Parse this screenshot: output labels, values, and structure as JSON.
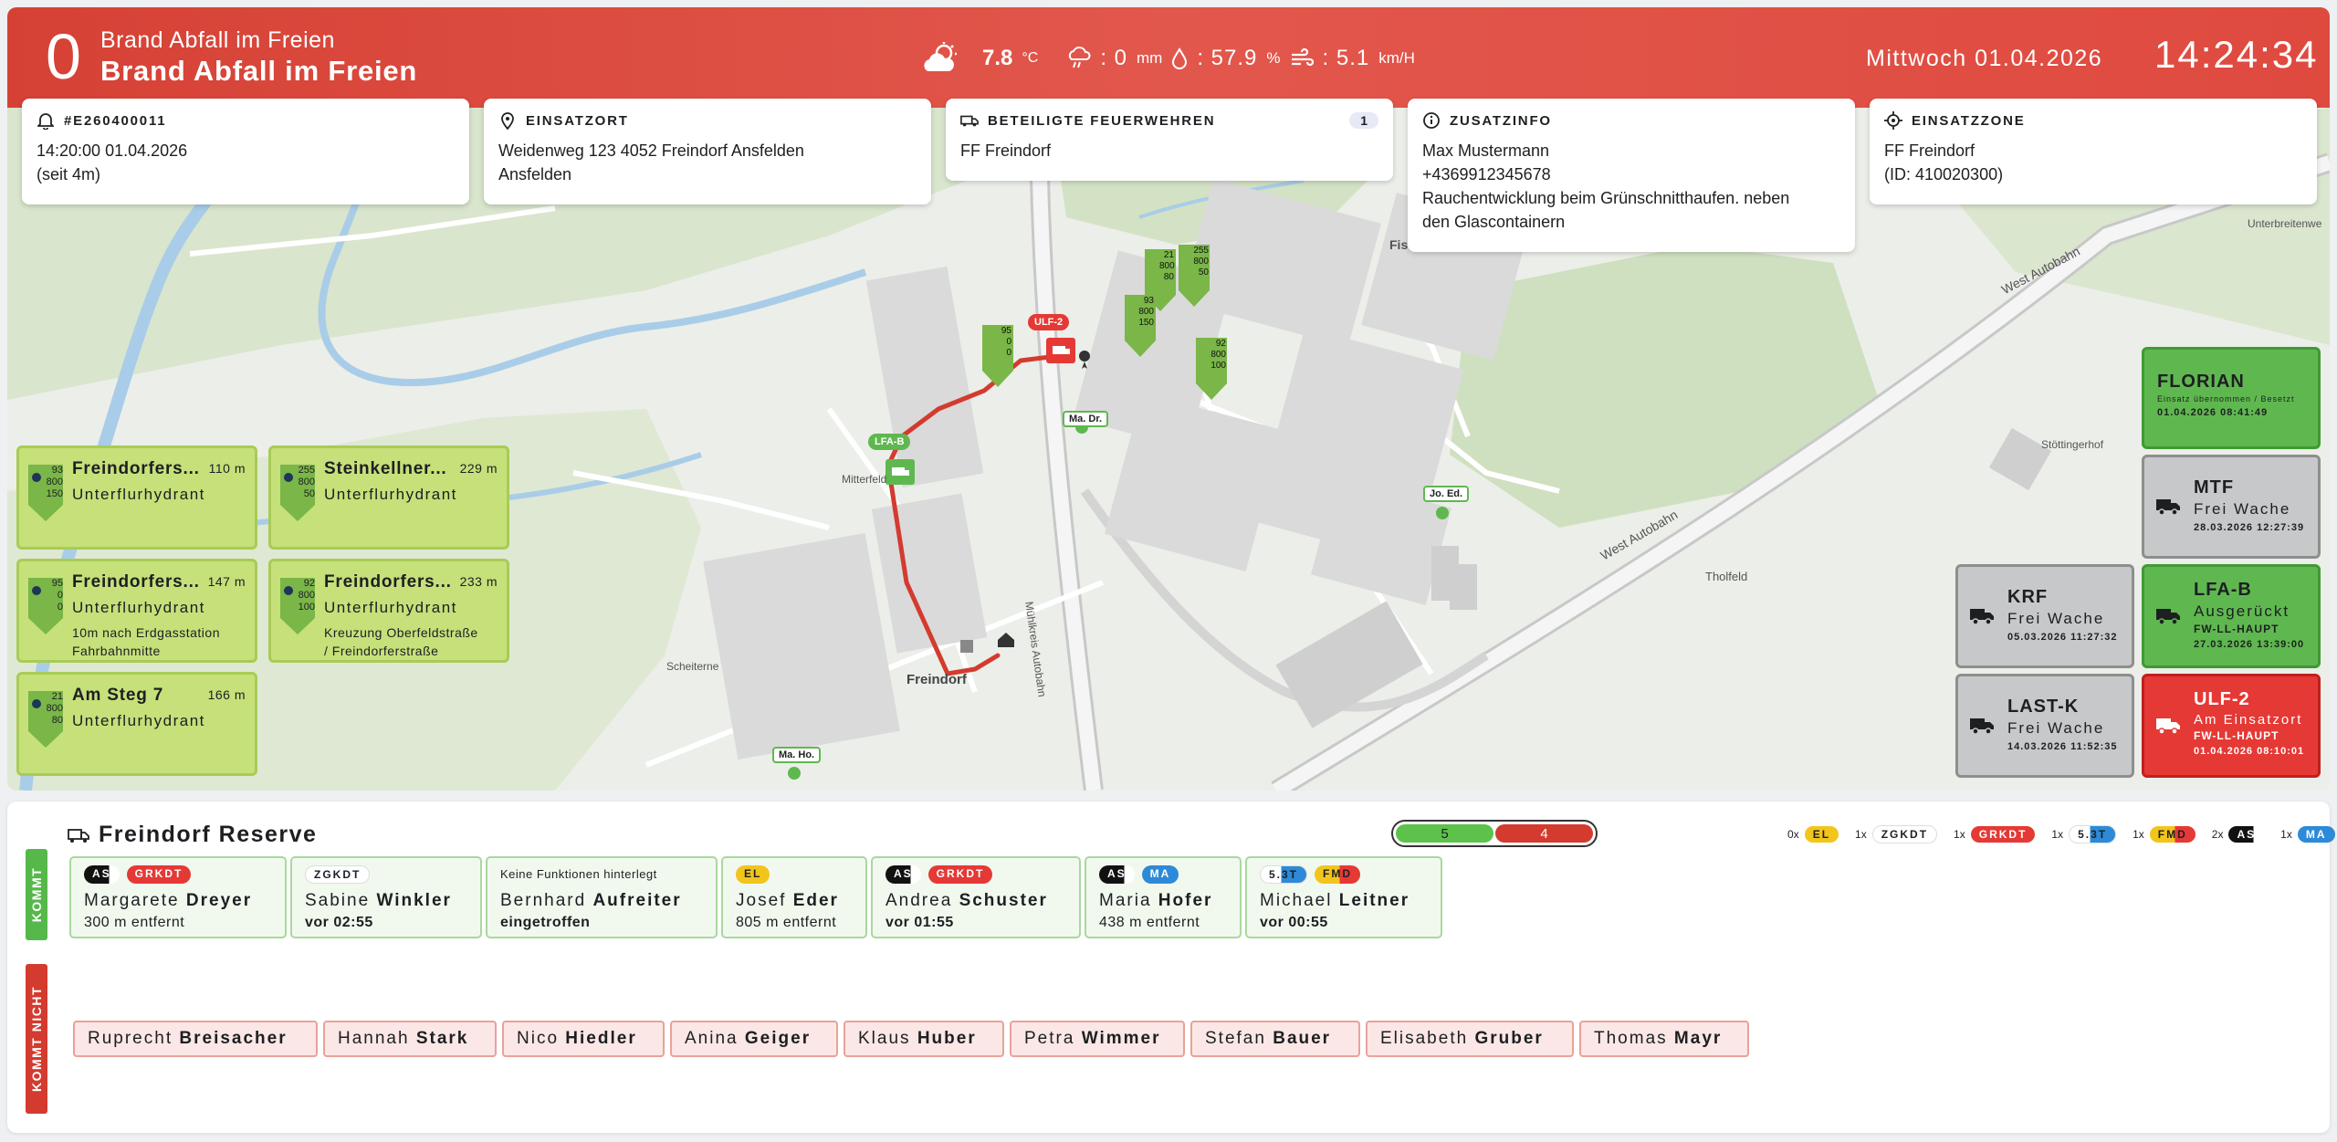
{
  "header": {
    "alarm_level": "0",
    "title_small": "Brand Abfall im Freien",
    "title_big": "Brand Abfall im Freien",
    "temperature": "7.8",
    "temp_unit": "°C",
    "rain": ": 0",
    "rain_unit": "mm",
    "humidity": ": 57.9",
    "humidity_unit": "%",
    "wind": ": 5.1",
    "wind_unit": "km/H",
    "date": "Mittwoch 01.04.2026",
    "time": "14:24:34"
  },
  "cards": {
    "incident": {
      "title": "#E260400011",
      "line1": "14:20:00 01.04.2026",
      "line2": "(seit 4m)"
    },
    "location": {
      "title": "EINSATZORT",
      "line1": "Weidenweg 123 4052 Freindorf Ansfelden",
      "line2": "Ansfelden"
    },
    "brigades": {
      "title": "BETEILIGTE FEUERWEHREN",
      "count": "1",
      "line1": "FF Freindorf"
    },
    "info": {
      "title": "ZUSATZINFO",
      "line1": "Max Mustermann",
      "line2": "+4369912345678",
      "line3": "Rauchentwicklung beim Grünschnitthaufen. neben",
      "line4": "den Glascontainern"
    },
    "zone": {
      "title": "EINSATZZONE",
      "line1": "FF Freindorf",
      "line2": "(ID: 410020300)"
    }
  },
  "hydrants": [
    {
      "name": "Freindorfers...",
      "dist": "110 m",
      "type": "Unterflurhydrant",
      "note1": "",
      "note2": "",
      "p1": "93",
      "p2": "800",
      "p3": "150"
    },
    {
      "name": "Steinkellner...",
      "dist": "229 m",
      "type": "Unterflurhydrant",
      "note1": "",
      "note2": "",
      "p1": "255",
      "p2": "800",
      "p3": "50"
    },
    {
      "name": "Freindorfers...",
      "dist": "147 m",
      "type": "Unterflurhydrant",
      "note1": "10m nach Erdgasstation",
      "note2": "Fahrbahnmitte",
      "p1": "95",
      "p2": "0",
      "p3": "0"
    },
    {
      "name": "Freindorfers...",
      "dist": "233 m",
      "type": "Unterflurhydrant",
      "note1": "Kreuzung Oberfeldstraße",
      "note2": "/ Freindorferstraße",
      "p1": "92",
      "p2": "800",
      "p3": "100"
    },
    {
      "name": "Am Steg 7",
      "dist": "166 m",
      "type": "Unterflurhydrant",
      "note1": "",
      "note2": "",
      "p1": "21",
      "p2": "800",
      "p3": "80"
    }
  ],
  "vehicles": {
    "florian": {
      "name": "FLORIAN",
      "status": "Einsatz übernommen / Besetzt",
      "time": "01.04.2026 08:41:49"
    },
    "mtf": {
      "name": "MTF",
      "status": "Frei Wache",
      "time": "28.03.2026 12:27:39"
    },
    "krf": {
      "name": "KRF",
      "status": "Frei Wache",
      "time": "05.03.2026 11:27:32"
    },
    "lfab": {
      "name": "LFA-B",
      "status": "Ausgerückt",
      "sub": "FW-LL-HAUPT",
      "time": "27.03.2026 13:39:00"
    },
    "lastk": {
      "name": "LAST-K",
      "status": "Frei Wache",
      "time": "14.03.2026 11:52:35"
    },
    "ulf2": {
      "name": "ULF-2",
      "status": "Am Einsatzort",
      "sub": "FW-LL-HAUPT",
      "time": "01.04.2026 08:10:01"
    }
  },
  "map": {
    "labels": {
      "freindorf": "Freindorf",
      "west_autobahn_1": "West Autobahn",
      "west_autobahn_2": "West Autobahn",
      "thalfeld": "Tholfeld",
      "stoettingerhof": "Stöttingerhof",
      "unterbreitenwe": "Unterbreitenwe",
      "muehlkreis": "Mühlkreis Autobahn",
      "mitterfeld": "Mitterfeld",
      "scheiterne": "Scheiterne",
      "fis": "Fis"
    },
    "pins": {
      "ma_dr": "Ma. Dr.",
      "jo_ed": "Jo. Ed.",
      "ma_ho": "Ma. Ho.",
      "lfab": "LFA-B",
      "ulf2": "ULF-2",
      "h1_a": "21",
      "h1_b": "800",
      "h1_c": "80",
      "h2_a": "255",
      "h2_b": "800",
      "h2_c": "50",
      "h3_a": "93",
      "h3_b": "800",
      "h3_c": "150",
      "h4_a": "95",
      "h4_b": "0",
      "h4_c": "0",
      "h5_a": "92",
      "h5_b": "800",
      "h5_c": "100"
    }
  },
  "crew": {
    "title": "Freindorf Reserve",
    "kommt_label": "KOMMT",
    "kommt_nicht_label": "KOMMT NICHT",
    "count_yes": "5",
    "count_no": "4",
    "summary": [
      {
        "count": "0x",
        "tag": "EL"
      },
      {
        "count": "1x",
        "tag": "ZGKDT"
      },
      {
        "count": "1x",
        "tag": "GRKDT"
      },
      {
        "count": "1x",
        "tag": "5.3T"
      },
      {
        "count": "1x",
        "tag": "FMD"
      },
      {
        "count": "2x",
        "tag": "AS"
      },
      {
        "count": "1x",
        "tag": "MA"
      }
    ],
    "coming": [
      {
        "first": "Margarete",
        "last": "Dreyer",
        "sub": "300 m entfernt",
        "t1": "AS",
        "t2": "GRKDT"
      },
      {
        "first": "Sabine",
        "last": "Winkler",
        "sub": "vor 02:55",
        "t1": "ZGKDT"
      },
      {
        "first": "Bernhard",
        "last": "Aufreiter",
        "sub": "eingetroffen",
        "nofn": "Keine Funktionen hinterlegt"
      },
      {
        "first": "Josef",
        "last": "Eder",
        "sub": "805 m entfernt",
        "t1": "EL"
      },
      {
        "first": "Andrea",
        "last": "Schuster",
        "sub": "vor 01:55",
        "t1": "AS",
        "t2": "GRKDT"
      },
      {
        "first": "Maria",
        "last": "Hofer",
        "sub": "438 m entfernt",
        "t1": "AS",
        "t2": "MA"
      },
      {
        "first": "Michael",
        "last": "Leitner",
        "sub": "vor 00:55",
        "t1": "5.3T",
        "t2": "FMD"
      }
    ],
    "not_coming": [
      {
        "first": "Ruprecht",
        "last": "Breisacher"
      },
      {
        "first": "Hannah",
        "last": "Stark"
      },
      {
        "first": "Nico",
        "last": "Hiedler"
      },
      {
        "first": "Anina",
        "last": "Geiger"
      },
      {
        "first": "Klaus",
        "last": "Huber"
      },
      {
        "first": "Petra",
        "last": "Wimmer"
      },
      {
        "first": "Stefan",
        "last": "Bauer"
      },
      {
        "first": "Elisabeth",
        "last": "Gruber"
      },
      {
        "first": "Thomas",
        "last": "Mayr"
      }
    ]
  }
}
